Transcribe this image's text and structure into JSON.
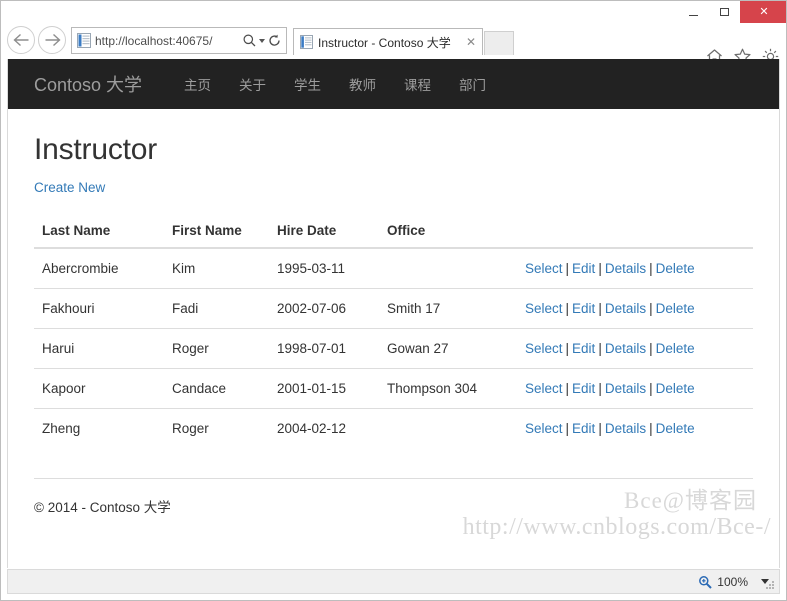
{
  "browser": {
    "window_controls": {
      "minimize": "—",
      "maximize": "❐",
      "close": "✕"
    },
    "back_label": "Back",
    "forward_label": "Forward",
    "address": {
      "url_prefix": "http://",
      "url_host": "localhost",
      "url_rest": ":40675/",
      "url_full": "http://localhost:40675/",
      "search_icon": "search-icon",
      "refresh_icon": "refresh-icon"
    },
    "tab": {
      "title": "Instructor - Contoso 大学",
      "close": "✕"
    },
    "toolbar_icons": [
      "home-icon",
      "favorites-star-icon",
      "settings-gear-icon"
    ],
    "status": {
      "zoom_label": "100%",
      "zoom_icon": "magnifier-icon"
    }
  },
  "site": {
    "brand": "Contoso 大学",
    "nav_items": [
      {
        "label": "主页",
        "name": "nav-home"
      },
      {
        "label": "关于",
        "name": "nav-about"
      },
      {
        "label": "学生",
        "name": "nav-students"
      },
      {
        "label": "教师",
        "name": "nav-instructors"
      },
      {
        "label": "课程",
        "name": "nav-courses"
      },
      {
        "label": "部门",
        "name": "nav-departments"
      }
    ],
    "nav_bg": "#222222",
    "nav_fg": "#9d9d9d",
    "link_color": "#337ab7"
  },
  "main": {
    "page_title": "Instructor",
    "create_new_label": "Create New",
    "table": {
      "headers": [
        "Last Name",
        "First Name",
        "Hire Date",
        "Office",
        ""
      ],
      "rows": [
        {
          "last_name": "Abercrombie",
          "first_name": "Kim",
          "hire_date": "1995-03-11",
          "office": "",
          "actions": [
            "Select",
            "Edit",
            "Details",
            "Delete"
          ]
        },
        {
          "last_name": "Fakhouri",
          "first_name": "Fadi",
          "hire_date": "2002-07-06",
          "office": "Smith 17",
          "actions": [
            "Select",
            "Edit",
            "Details",
            "Delete"
          ]
        },
        {
          "last_name": "Harui",
          "first_name": "Roger",
          "hire_date": "1998-07-01",
          "office": "Gowan 27",
          "actions": [
            "Select",
            "Edit",
            "Details",
            "Delete"
          ]
        },
        {
          "last_name": "Kapoor",
          "first_name": "Candace",
          "hire_date": "2001-01-15",
          "office": "Thompson 304",
          "actions": [
            "Select",
            "Edit",
            "Details",
            "Delete"
          ]
        },
        {
          "last_name": "Zheng",
          "first_name": "Roger",
          "hire_date": "2004-02-12",
          "office": "",
          "actions": [
            "Select",
            "Edit",
            "Details",
            "Delete"
          ]
        }
      ],
      "action_separator": "|"
    },
    "footer": "© 2014 - Contoso 大学"
  },
  "watermark": {
    "line1": "Bce@博客园",
    "line2": "http://www.cnblogs.com/Bce-/"
  }
}
